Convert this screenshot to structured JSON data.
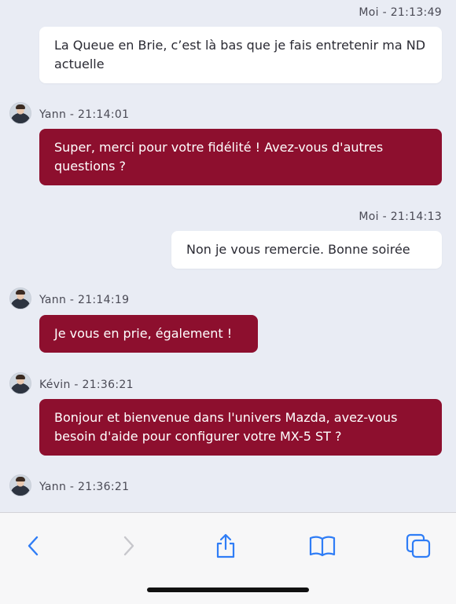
{
  "messages": [
    {
      "sender": "Moi",
      "time": "21:13:49",
      "meta": "Moi - 21:13:49",
      "text": "La Queue en Brie, c’est là bas que je fais entretenir ma ND actuelle"
    },
    {
      "sender": "Yann",
      "time": "21:14:01",
      "meta": "Yann - 21:14:01",
      "text": "Super, merci pour votre fidélité ! Avez-vous d'autres questions ?"
    },
    {
      "sender": "Moi",
      "time": "21:14:13",
      "meta": "Moi - 21:14:13",
      "text": "Non je vous remercie. Bonne soirée"
    },
    {
      "sender": "Yann",
      "time": "21:14:19",
      "meta": "Yann - 21:14:19",
      "text": "Je vous en prie, également !"
    },
    {
      "sender": "Kévin",
      "time": "21:36:21",
      "meta": "Kévin - 21:36:21",
      "text": "Bonjour et bienvenue dans l'univers Mazda, avez-vous besoin d'aide pour configurer votre MX-5 ST ?"
    },
    {
      "sender": "Yann",
      "time": "21:36:21",
      "meta": "Yann - 21:36:21",
      "text": ""
    }
  ],
  "colors": {
    "agent_bubble": "#8d0f2e",
    "user_bubble": "#ffffff",
    "chat_background": "#e9ecf4",
    "toolbar_icon_active": "#2f7df6",
    "toolbar_icon_disabled": "#c7c7cc"
  },
  "toolbar": {
    "icons": [
      "back-chevron-icon",
      "forward-chevron-icon",
      "share-icon",
      "bookmarks-icon",
      "tabs-icon"
    ]
  }
}
